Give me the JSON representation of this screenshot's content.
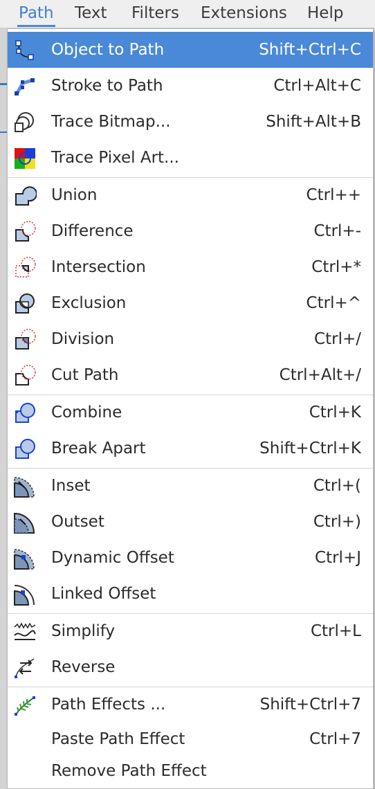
{
  "menubar": [
    "Path",
    "Text",
    "Filters",
    "Extensions",
    "Help"
  ],
  "menu": {
    "items": [
      {
        "label": "Object to Path",
        "shortcut": "Shift+Ctrl+C",
        "icon": "object-to-path-icon"
      },
      {
        "label": "Stroke to Path",
        "shortcut": "Ctrl+Alt+C",
        "icon": "stroke-to-path-icon"
      },
      {
        "label": "Trace Bitmap...",
        "shortcut": "Shift+Alt+B",
        "icon": "trace-bitmap-icon"
      },
      {
        "label": "Trace Pixel Art...",
        "shortcut": "",
        "icon": "trace-pixel-art-icon"
      },
      {
        "label": "Union",
        "shortcut": "Ctrl++",
        "icon": "union-icon"
      },
      {
        "label": "Difference",
        "shortcut": "Ctrl+-",
        "icon": "difference-icon"
      },
      {
        "label": "Intersection",
        "shortcut": "Ctrl+*",
        "icon": "intersection-icon"
      },
      {
        "label": "Exclusion",
        "shortcut": "Ctrl+^",
        "icon": "exclusion-icon"
      },
      {
        "label": "Division",
        "shortcut": "Ctrl+/",
        "icon": "division-icon"
      },
      {
        "label": "Cut Path",
        "shortcut": "Ctrl+Alt+/",
        "icon": "cut-path-icon"
      },
      {
        "label": "Combine",
        "shortcut": "Ctrl+K",
        "icon": "combine-icon"
      },
      {
        "label": "Break Apart",
        "shortcut": "Shift+Ctrl+K",
        "icon": "break-apart-icon"
      },
      {
        "label": "Inset",
        "shortcut": "Ctrl+(",
        "icon": "inset-icon"
      },
      {
        "label": "Outset",
        "shortcut": "Ctrl+)",
        "icon": "outset-icon"
      },
      {
        "label": "Dynamic Offset",
        "shortcut": "Ctrl+J",
        "icon": "dynamic-offset-icon"
      },
      {
        "label": "Linked Offset",
        "shortcut": "",
        "icon": "linked-offset-icon"
      },
      {
        "label": "Simplify",
        "shortcut": "Ctrl+L",
        "icon": "simplify-icon"
      },
      {
        "label": "Reverse",
        "shortcut": "",
        "icon": "reverse-icon"
      },
      {
        "label": "Path Effects ...",
        "shortcut": "Shift+Ctrl+7",
        "icon": "path-effects-icon"
      },
      {
        "label": "Paste Path Effect",
        "shortcut": "Ctrl+7",
        "icon": ""
      },
      {
        "label": "Remove Path Effect",
        "shortcut": "",
        "icon": ""
      }
    ]
  },
  "colors": {
    "highlight": "#4a89d8",
    "menubar_active": "#3f7fd0"
  }
}
